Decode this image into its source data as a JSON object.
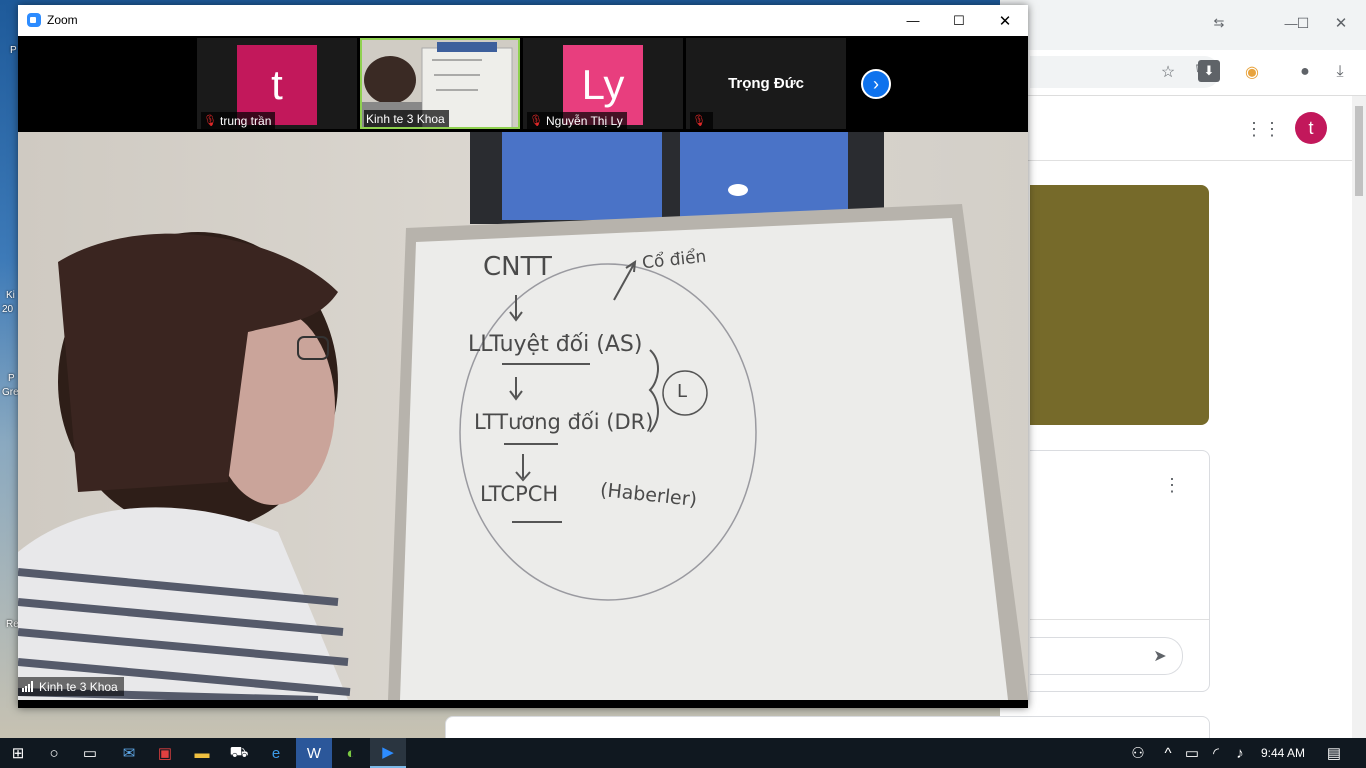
{
  "zoom": {
    "title": "Zoom",
    "participants": [
      {
        "name": "trung trần",
        "initial": "t",
        "color": "#c2185b"
      },
      {
        "name": "Kinh te 3 Khoa"
      },
      {
        "name": "Nguyễn Thị Ly",
        "initial": "Ly",
        "color": "#e91e63"
      },
      {
        "name": "Trọng Đức"
      }
    ],
    "active_speaker": "Kinh te 3 Khoa"
  },
  "whiteboard": {
    "lines": [
      "CNTT",
      "Cổ điển",
      "LLTuyệt đối (AS)",
      "LTTương đối (DR)",
      "LTCPCH",
      "(Haberler)",
      "L"
    ]
  },
  "chrome": {
    "avatar_initial": "t",
    "olive_color": "#766a2a"
  },
  "taskbar": {
    "time": "9:44 AM"
  }
}
